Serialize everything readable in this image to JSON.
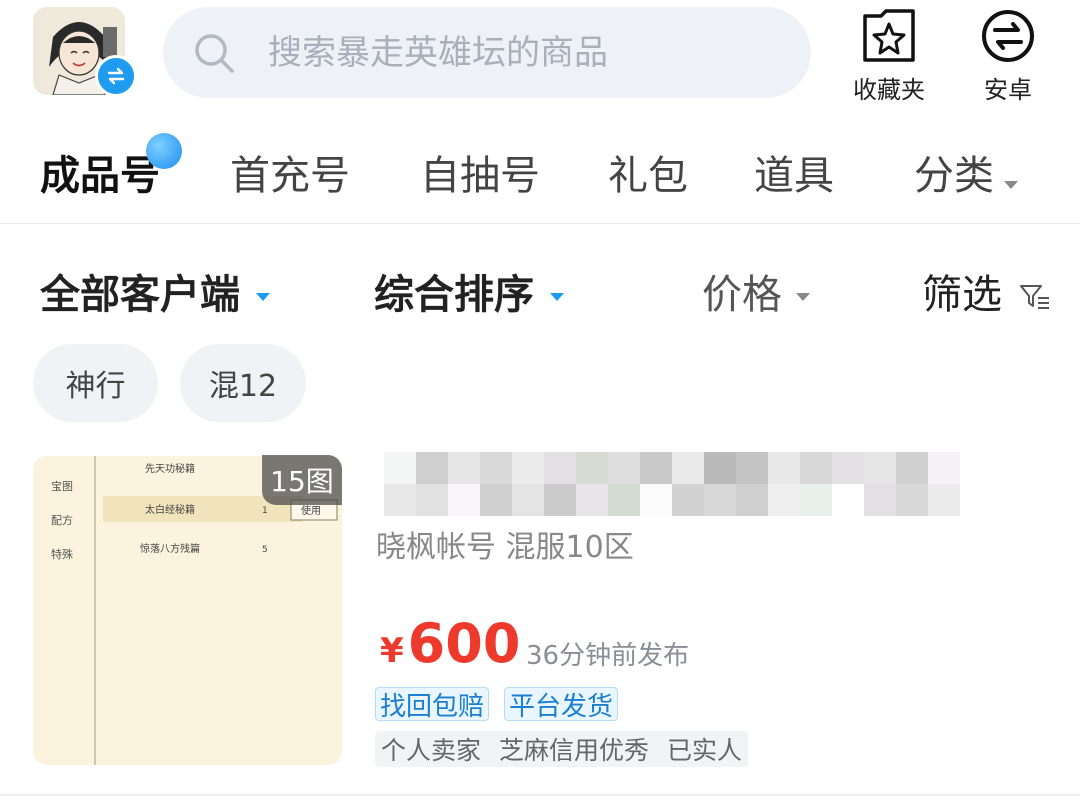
{
  "header": {
    "search_placeholder": "搜索暴走英雄坛的商品",
    "actions": [
      {
        "label": "收藏夹",
        "icon": "star-folder-icon"
      },
      {
        "label": "安卓",
        "icon": "switch-arrows-icon"
      }
    ]
  },
  "tabs": [
    {
      "label": "成品号",
      "active": true
    },
    {
      "label": "首充号",
      "active": false
    },
    {
      "label": "自抽号",
      "active": false
    },
    {
      "label": "礼包",
      "active": false
    },
    {
      "label": "道具",
      "active": false
    },
    {
      "label": "分类",
      "active": false
    }
  ],
  "filters": {
    "client": "全部客户端",
    "sort": "综合排序",
    "price": "价格",
    "screen": "筛选"
  },
  "chips": [
    "神行",
    "混12"
  ],
  "listing": {
    "image_count": "15图",
    "seller_server": "晓枫帐号 混服10区",
    "price_symbol": "¥",
    "price": "600",
    "posted": "36分钟前发布",
    "tags": [
      "找回包赔",
      "平台发货"
    ],
    "trust": [
      "个人卖家",
      "芝麻信用优秀",
      "已实人"
    ],
    "thumb_text": {
      "menu": [
        "宝图",
        "配方",
        "特殊"
      ],
      "books": [
        "先天功秘籍",
        "太白经秘籍",
        "惊落八方残篇"
      ],
      "counts": [
        "1",
        "5"
      ],
      "use": "使用"
    }
  },
  "colors": {
    "accent_blue": "#1a9cf2",
    "price_red": "#ee3a2c",
    "search_bg": "#eef2f7"
  }
}
